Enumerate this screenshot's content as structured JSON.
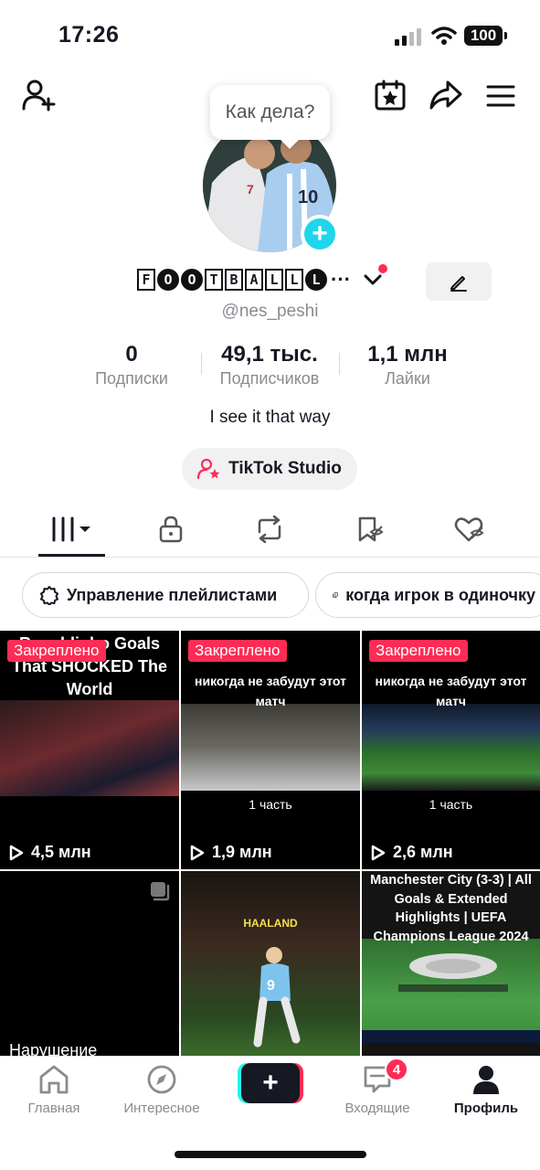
{
  "status_bar": {
    "time": "17:26",
    "battery": "100"
  },
  "profile": {
    "tooltip": "Как дела?",
    "avatar_add": "+",
    "username_letters": [
      "F",
      "O",
      "O",
      "T",
      "B",
      "A",
      "L",
      "L",
      "L"
    ],
    "username_suffix": "···",
    "handle": "@nes_peshi",
    "stats": [
      {
        "value": "0",
        "label": "Подписки"
      },
      {
        "value": "49,1 тыс.",
        "label": "Подписчиков"
      },
      {
        "value": "1,1 млн",
        "label": "Лайки"
      }
    ],
    "bio": "I see it that way",
    "studio_label": "TikTok Studio"
  },
  "chips": [
    "Управление плейлистами",
    "когда игрок в одиночку"
  ],
  "videos": [
    {
      "pinned": "Закреплено",
      "caption": "Ronaldinho Goals That SHOCKED The World",
      "views": "4,5 млн"
    },
    {
      "pinned": "Закреплено",
      "caption": "никогда не забудут этот матч",
      "part": "1 часть",
      "views": "1,9 млн"
    },
    {
      "pinned": "Закреплено",
      "caption": "никогда не забудут этот матч",
      "part": "1 часть",
      "views": "2,6 млн"
    },
    {
      "caption": "Нарушение"
    },
    {
      "caption": "HAALAND"
    },
    {
      "caption": "Manchester City (3-3) | All Goals & Extended Highlights | UEFA Champions League 2024"
    }
  ],
  "nav": {
    "home": "Главная",
    "explore": "Интересное",
    "create": "+",
    "inbox": "Входящие",
    "inbox_badge": "4",
    "profile": "Профиль"
  },
  "colors": {
    "accent": "#fe2c55",
    "cyan": "#20d5ec",
    "text": "#161823",
    "muted": "#8a8b91"
  }
}
